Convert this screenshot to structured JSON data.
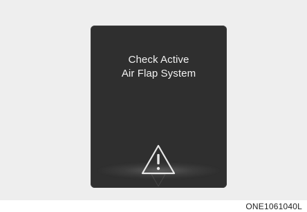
{
  "display": {
    "message_line1": "Check Active",
    "message_line2": "Air Flap System",
    "icon": "warning-triangle-icon"
  },
  "figure_code": "ONE1061040L",
  "colors": {
    "panel_background": "#eeeeee",
    "screen_background": "#2f2f2f",
    "text": "#f2f2f2"
  }
}
